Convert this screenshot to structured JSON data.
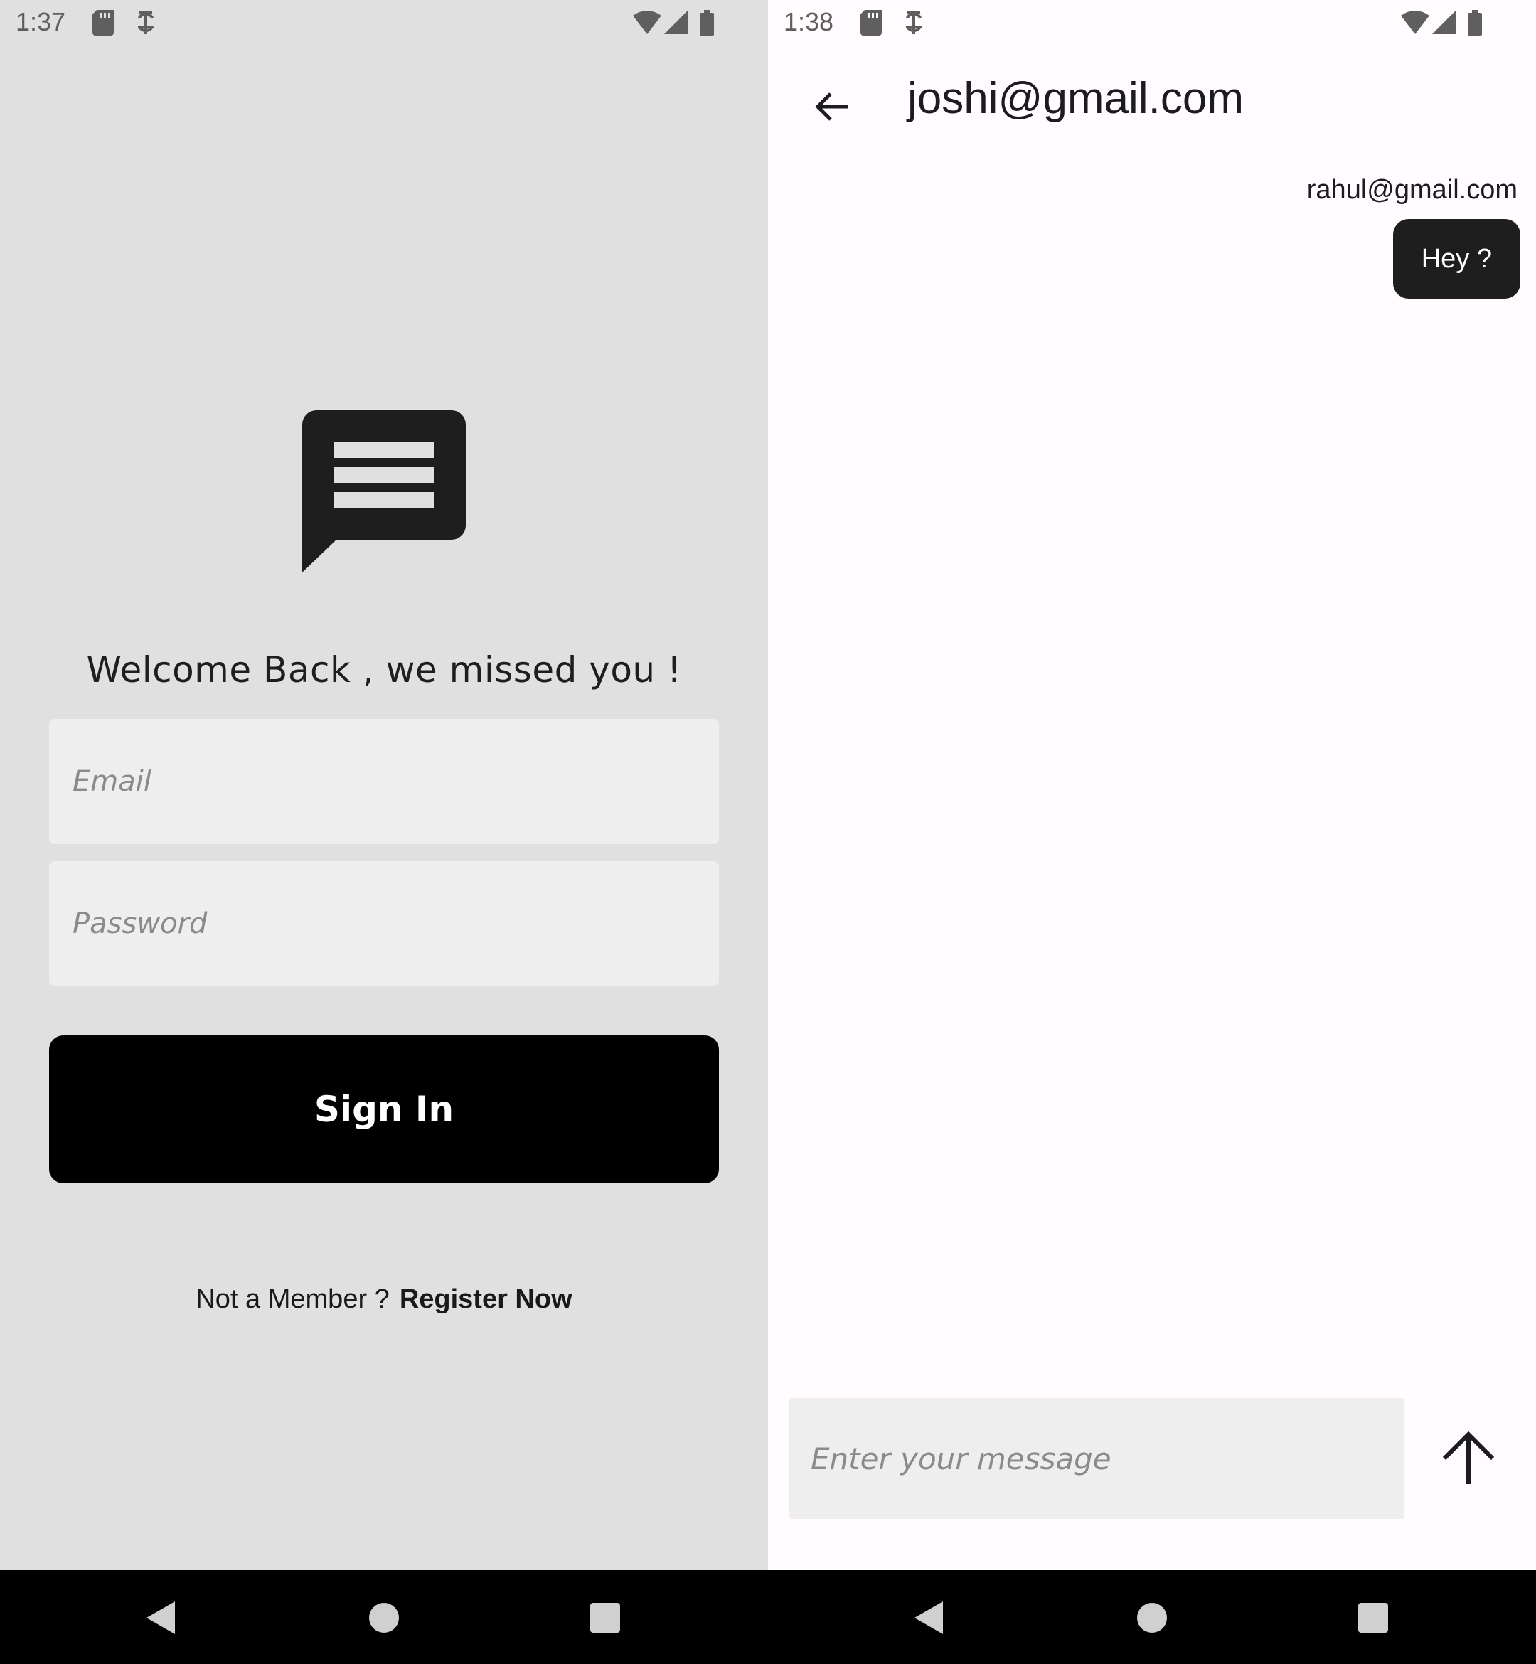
{
  "left": {
    "status": {
      "time": "1:37"
    },
    "welcome": "Welcome Back , we missed you !",
    "email_placeholder": "Email",
    "password_placeholder": "Password",
    "sign_in_label": "Sign In",
    "not_member_text": "Not a Member ?",
    "register_label": "Register Now"
  },
  "right": {
    "status": {
      "time": "1:38"
    },
    "chat_title": "joshi@gmail.com",
    "messages": [
      {
        "sender": "rahul@gmail.com",
        "text": "Hey ?"
      }
    ],
    "message_placeholder": "Enter your message"
  },
  "colors": {
    "login_bg": "#e0e0e0",
    "chat_bg": "#fffbfe",
    "accent": "#000000",
    "bubble": "#1e1e1e"
  },
  "icons": [
    "sd-card-icon",
    "alarm-icon",
    "wifi-icon",
    "signal-icon",
    "battery-icon",
    "chat-logo-icon",
    "back-arrow-icon",
    "send-arrow-icon",
    "nav-back-icon",
    "nav-home-icon",
    "nav-recent-icon"
  ]
}
